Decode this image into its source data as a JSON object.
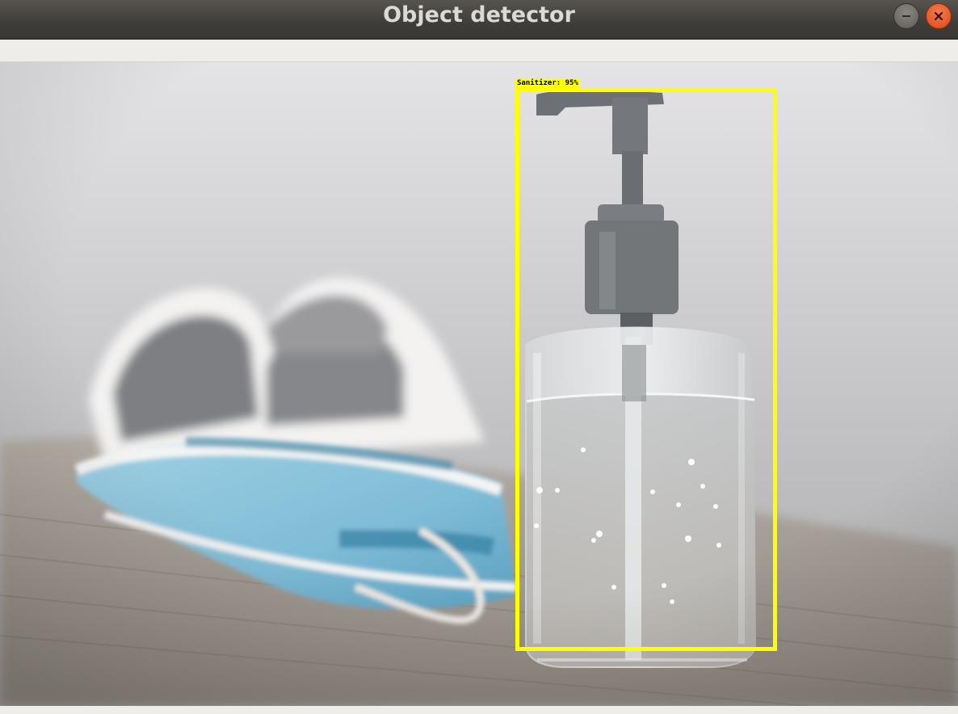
{
  "window": {
    "title": "Object detector",
    "minimize_icon": "minimize-icon",
    "close_icon": "close-icon"
  },
  "detections": [
    {
      "label": "Sanitizer: 95%",
      "class": "Sanitizer",
      "confidence": 95,
      "box_color": "#ffff00"
    }
  ],
  "colors": {
    "titlebar": "#3f3d39",
    "close_button": "#e2561f",
    "bbox": "#ffff00"
  }
}
